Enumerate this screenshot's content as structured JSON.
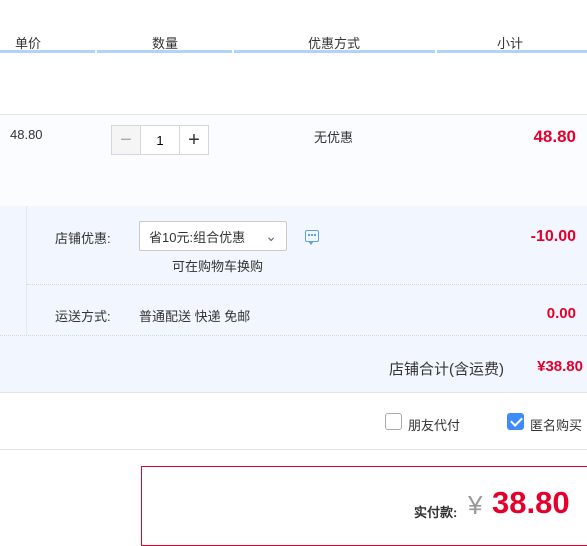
{
  "header": {
    "col_price": "单价",
    "col_qty": "数量",
    "col_promo": "优惠方式",
    "col_subtotal": "小计",
    "accent_color": "#b2d1ff"
  },
  "item": {
    "price": "48.80",
    "qty_value": "1",
    "minus_label": "−",
    "plus_label": "+",
    "promo": "无优惠",
    "subtotal": "48.80"
  },
  "store": {
    "promo_label": "店铺优惠:",
    "promo_select_value": "省10元:组合优惠",
    "promo_swap_text": "可在购物车换购",
    "discount": "-10.00",
    "ship_label": "运送方式:",
    "ship_method": "普通配送 快递 免邮",
    "ship_cost": "0.00",
    "total_label": "店铺合计(含运费)",
    "total_value": "¥38.80"
  },
  "options": {
    "friend_pay_label": "朋友代付",
    "friend_pay_checked": false,
    "anonymous_label": "匿名购买",
    "anonymous_checked": true
  },
  "payment": {
    "label": "实付款:",
    "currency": "¥",
    "amount": "38.80",
    "accent_color": "#e4002b"
  }
}
